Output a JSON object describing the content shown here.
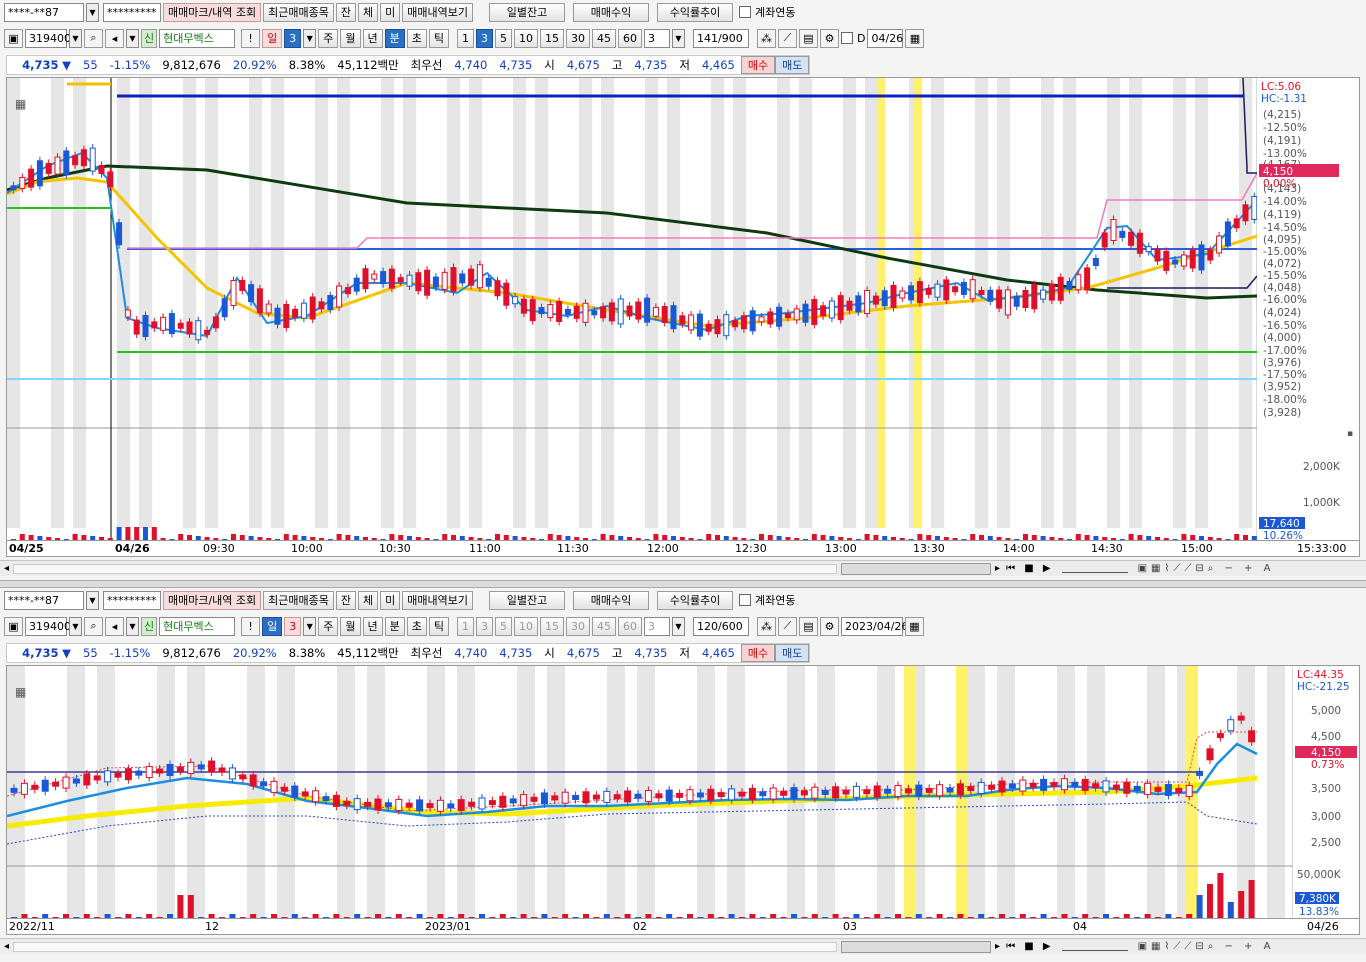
{
  "toolbar": {
    "account_mask": "****-**87",
    "password_mask": "*********",
    "buttons": [
      "매매마크/내역 조회",
      "최근매매종목",
      "잔",
      "체",
      "미",
      "매매내역보기",
      "일별잔고",
      "매매수익",
      "수익률추이"
    ],
    "link_label": "계좌연동"
  },
  "top": {
    "stock_code": "319400",
    "stock_badge": "신",
    "stock_name": "현대무벡스",
    "period_buttons": [
      "일",
      "주",
      "월",
      "년",
      "분",
      "초",
      "틱"
    ],
    "selected_period": "분",
    "period_count": "3",
    "interval_buttons": [
      "1",
      "3",
      "5",
      "10",
      "15",
      "30",
      "45",
      "60"
    ],
    "interval_selected": "3",
    "interval_input": "3",
    "bar_count": "141/900",
    "date": "04/26",
    "date_prefix": "D",
    "x_labels": [
      "04/25",
      "04/26",
      "09:30",
      "10:00",
      "10:30",
      "11:00",
      "11:30",
      "12:00",
      "12:30",
      "13:00",
      "13:30",
      "14:00",
      "14:30",
      "15:00",
      "15:33:00"
    ],
    "y_labels": [
      "LC:5.06",
      "HC:-1.31",
      "(4,215)",
      "-12.50%",
      "(4,191)",
      "-13.00%",
      "(4,167)",
      "4,150",
      "0.00%",
      "(4,143)",
      "-14.00%",
      "(4,119)",
      "-14.50%",
      "(4,095)",
      "-15.00%",
      "(4,072)",
      "-15.50%",
      "(4,048)",
      "-16.00%",
      "(4,024)",
      "-16.50%",
      "(4,000)",
      "-17.00%",
      "(3,976)",
      "-17.50%",
      "(3,952)",
      "-18.00%",
      "(3,928)"
    ],
    "vol_labels": [
      "2,000K",
      "1,000K",
      "17,640",
      "10.26%"
    ]
  },
  "bottom": {
    "stock_code": "319400",
    "stock_badge": "신",
    "stock_name": "현대무벡스",
    "period_buttons": [
      "일",
      "주",
      "월",
      "년",
      "분",
      "초",
      "틱"
    ],
    "selected_period": "일",
    "period_count": "3",
    "interval_buttons": [
      "1",
      "3",
      "5",
      "10",
      "15",
      "30",
      "45",
      "60"
    ],
    "interval_input": "3",
    "bar_count": "120/600",
    "date": "2023/04/26",
    "x_labels": [
      "2022/11",
      "12",
      "2023/01",
      "02",
      "03",
      "04",
      "04/26"
    ],
    "y_labels": [
      "LC:44.35",
      "HC:-21.25",
      "5,000",
      "4,500",
      "4,150",
      "0.73%",
      "3,500",
      "3,000",
      "2,500"
    ],
    "vol_labels": [
      "50,000K",
      "7,380K",
      "13.83%"
    ]
  },
  "quote": {
    "price": "4,735",
    "arrow": "▼",
    "change": "55",
    "change_pct": "-1.15%",
    "volume": "9,812,676",
    "turnover_pct": "20.92%",
    "ratio": "8.38%",
    "amount": "45,112백만",
    "best_label": "최우선",
    "best_ask": "4,740",
    "best_bid": "4,735",
    "open_label": "시",
    "open": "4,675",
    "high_label": "고",
    "high": "4,735",
    "low_label": "저",
    "low": "4,465",
    "buy_label": "매수",
    "sell_label": "매도"
  },
  "colors": {
    "up": "#e0102a",
    "down": "#1a58d6",
    "highlight": "#fff26a",
    "shade": "#e6e6e6"
  }
}
